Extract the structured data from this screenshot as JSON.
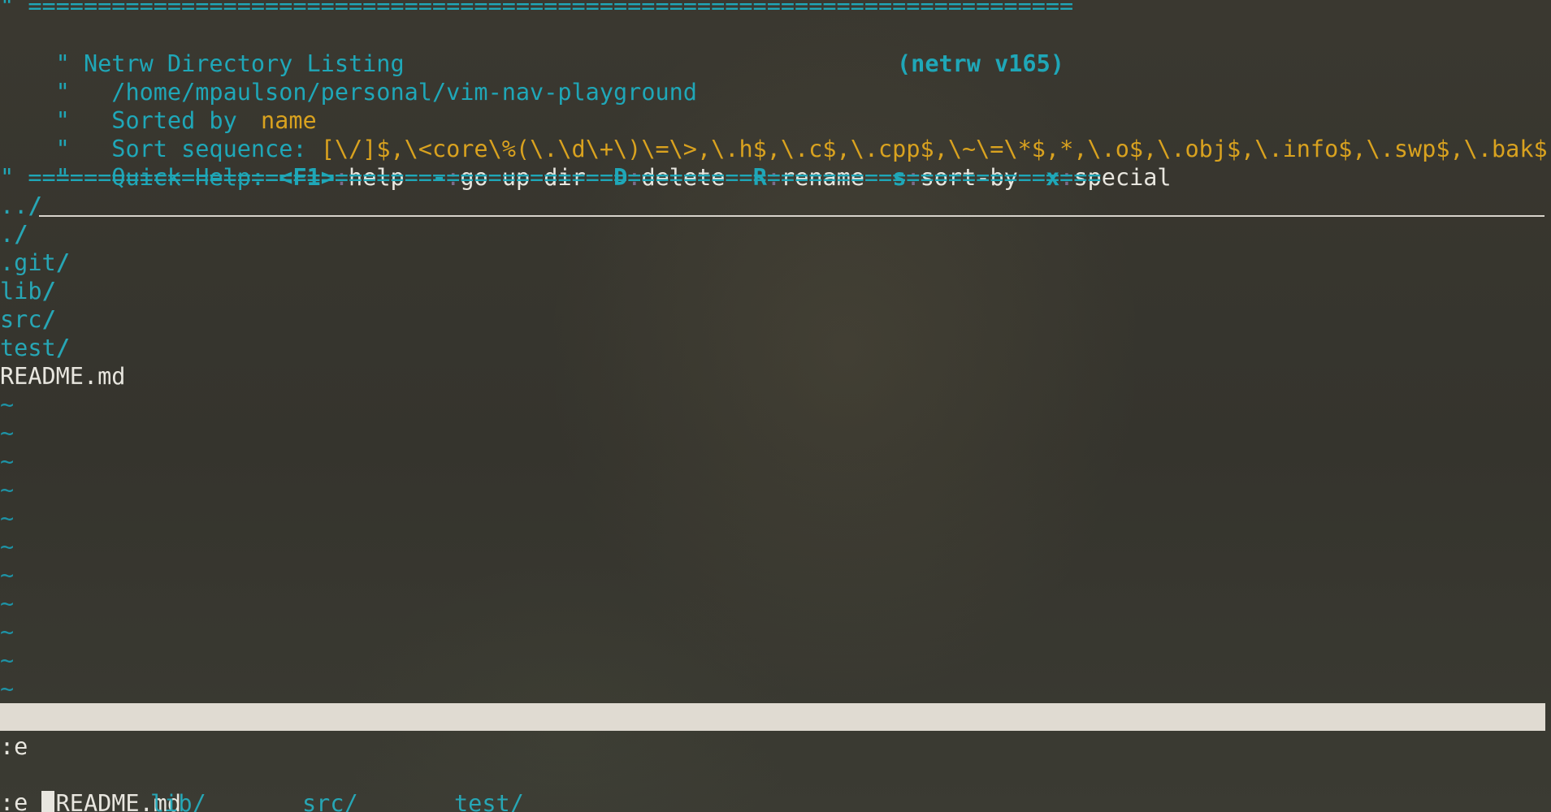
{
  "header": {
    "rule_top": "\" ===========================================================================",
    "title_prefix": "\" ",
    "title": "Netrw Directory Listing",
    "version": "(netrw v165)",
    "path": "/home/mpaulson/personal/vim-nav-playground",
    "sorted_by_label": "Sorted by",
    "sorted_by_value": "name",
    "sort_sequence_label": "Sort sequence:",
    "sort_sequence_value": "[\\/]$,\\<core\\%(\\.\\d\\+\\)\\=\\>,\\.h$,\\.c$,\\.cpp$,\\~\\=\\*$,*,\\.o$,\\.obj$,\\.info$,\\.swp$,\\.bak$,\\~$",
    "quick_help_label": "Quick Help:",
    "quick_help": [
      {
        "key": "<F1>",
        "action": "help"
      },
      {
        "key": "-",
        "action": "go up dir"
      },
      {
        "key": "D",
        "action": "delete"
      },
      {
        "key": "R",
        "action": "rename"
      },
      {
        "key": "s",
        "action": "sort-by"
      },
      {
        "key": "x",
        "action": "special"
      }
    ],
    "rule_bottom": "\" =============================================================================",
    "quote": "\""
  },
  "listing": {
    "entries": [
      {
        "name": "..",
        "slash": "/"
      },
      {
        "name": ".",
        "slash": "/"
      },
      {
        "name": ".git",
        "slash": "/"
      },
      {
        "name": "lib",
        "slash": "/"
      },
      {
        "name": "src",
        "slash": "/"
      },
      {
        "name": "test",
        "slash": "/"
      },
      {
        "name": "README.md",
        "slash": ""
      }
    ]
  },
  "filler": {
    "tilde": "~"
  },
  "cmdline": {
    "line1": ":e",
    "completions": [
      "README.md",
      "lib/",
      "src/",
      "test/"
    ],
    "line3": ":e "
  },
  "colors": {
    "background": "#37352e",
    "comment": "#1fa7b8",
    "string": "#d9a21f",
    "directory": "#27a6b5",
    "statusline": "#e0dbd2"
  }
}
